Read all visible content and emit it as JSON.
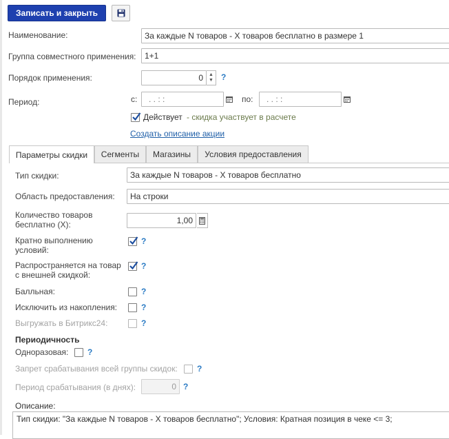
{
  "toolbar": {
    "save_close_label": "Записать и закрыть",
    "save_icon": "floppy-disk-icon"
  },
  "form": {
    "name_label": "Наименование:",
    "name_value": "За каждые N товаров - X товаров бесплатно в размере 1",
    "group_label": "Группа совместного применения:",
    "group_value": "1+1",
    "order_label": "Порядок применения:",
    "order_value": "0",
    "period_label": "Период:",
    "period_from_label": "с:",
    "period_from_value": ".  .     :  :",
    "period_to_label": "по:",
    "period_to_value": ".  .     :  :",
    "active_label": "Действует",
    "active_checked": true,
    "active_note": "- скидка участвует в расчете",
    "create_description_link": "Создать описание акции",
    "help_mark": "?"
  },
  "tabs": [
    {
      "label": "Параметры скидки",
      "active": true
    },
    {
      "label": "Сегменты",
      "active": false
    },
    {
      "label": "Магазины",
      "active": false
    },
    {
      "label": "Условия предоставления",
      "active": false
    }
  ],
  "params": {
    "discount_type_label": "Тип скидки:",
    "discount_type_value": "За каждые N товаров - X товаров бесплатно",
    "area_label": "Область предоставления:",
    "area_value": "На строки",
    "free_qty_label": "Количество товаров бесплатно (X):",
    "free_qty_value": "1,00",
    "multiple_label": "Кратно выполнению условий:",
    "multiple_checked": true,
    "external_label": "Распространяется на товар с внешней скидкой:",
    "external_checked": true,
    "points_label": "Балльная:",
    "points_checked": false,
    "exclude_label": "Исключить из накопления:",
    "exclude_checked": false,
    "bitrix_label": "Выгружать в Битрикс24:",
    "bitrix_checked": false
  },
  "periodicity": {
    "title": "Периодичность",
    "one_time_label": "Одноразовая:",
    "one_time_checked": false,
    "group_ban_label": "Запрет срабатывания всей группы скидок:",
    "group_ban_checked": false,
    "period_days_label": "Период срабатывания (в днях):",
    "period_days_value": "0"
  },
  "description": {
    "label": "Описание:",
    "text": "Тип скидки: \"За каждые N товаров - X товаров бесплатно\"; Условия: Кратная позиция в чеке <= 3;"
  },
  "colors": {
    "primary_button": "#1e40af",
    "help": "#2b7bc4",
    "link": "#1f5fa8",
    "note": "#6b7b4c"
  }
}
